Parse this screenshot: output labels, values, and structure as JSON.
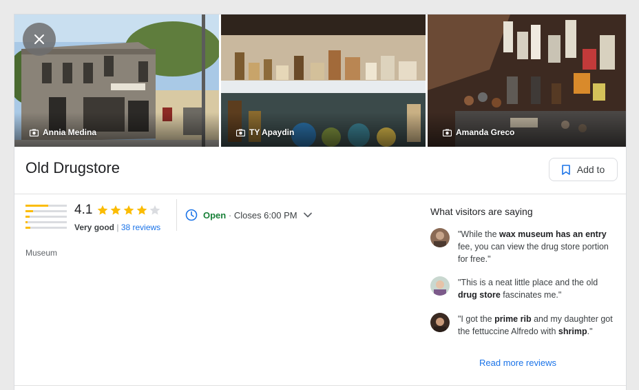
{
  "photos": [
    {
      "credit": "Annia Medina"
    },
    {
      "credit": "TY Apaydin"
    },
    {
      "credit": "Amanda Greco"
    }
  ],
  "place": {
    "name": "Old Drugstore",
    "add_to_label": "Add to",
    "category": "Museum"
  },
  "rating": {
    "score": "4.1",
    "stars": 4,
    "distribution": [
      0.55,
      0.18,
      0.1,
      0.05,
      0.12
    ],
    "quality_label": "Very good",
    "separator": "|",
    "reviews_link": "38 reviews"
  },
  "hours": {
    "status": "Open",
    "dot": "·",
    "closes": "Closes 6:00 PM"
  },
  "visitors": {
    "heading": "What visitors are saying",
    "reviews": [
      {
        "segments": [
          {
            "text": "\"While the ",
            "bold": false
          },
          {
            "text": "wax museum has an entry",
            "bold": true
          },
          {
            "text": " fee, you can view the drug store portion for free.\"",
            "bold": false
          }
        ]
      },
      {
        "segments": [
          {
            "text": "\"This is a neat little place and the old ",
            "bold": false
          },
          {
            "text": "drug store",
            "bold": true
          },
          {
            "text": " fascinates me.\"",
            "bold": false
          }
        ]
      },
      {
        "segments": [
          {
            "text": "\"I got the ",
            "bold": false
          },
          {
            "text": "prime rib",
            "bold": true
          },
          {
            "text": " and my daughter got the fettuccine Alfredo with ",
            "bold": false
          },
          {
            "text": "shrimp",
            "bold": true
          },
          {
            "text": ".\"",
            "bold": false
          }
        ]
      }
    ],
    "read_more": "Read more reviews"
  },
  "colors": {
    "accent": "#1a73e8",
    "open": "#188038",
    "star": "#fbbc04"
  }
}
